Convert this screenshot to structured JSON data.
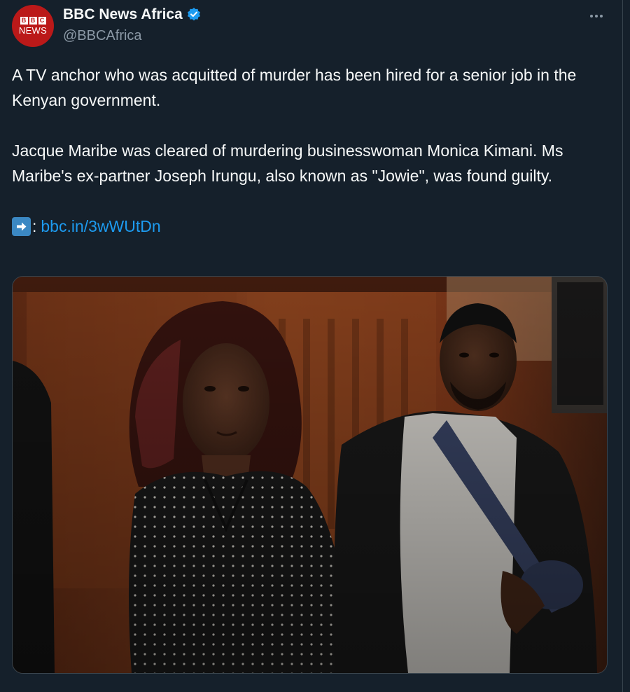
{
  "account": {
    "display_name": "BBC News Africa",
    "handle": "@BBCAfrica",
    "avatar_logo": "BBC",
    "avatar_sub": "NEWS",
    "verified": true
  },
  "icons": {
    "verified": "verified-badge-icon",
    "more": "more-options-icon",
    "arrow": "right-arrow-emoji-icon"
  },
  "tweet": {
    "paragraphs": [
      "A TV anchor who was acquitted of murder has been hired for a senior job in the Kenyan government.",
      "Jacque Maribe was cleared of murdering businesswoman Monica Kimani. Ms Maribe's ex-partner Joseph Irungu, also known as \"Jowie\", was found guilty."
    ],
    "link_prefix": ":",
    "link_text": "bbc.in/3wWUtDn"
  },
  "colors": {
    "background": "#15202b",
    "text": "#f7f9f9",
    "muted": "#8b98a5",
    "link": "#1d9bf0",
    "bbc_red": "#bb1919"
  }
}
